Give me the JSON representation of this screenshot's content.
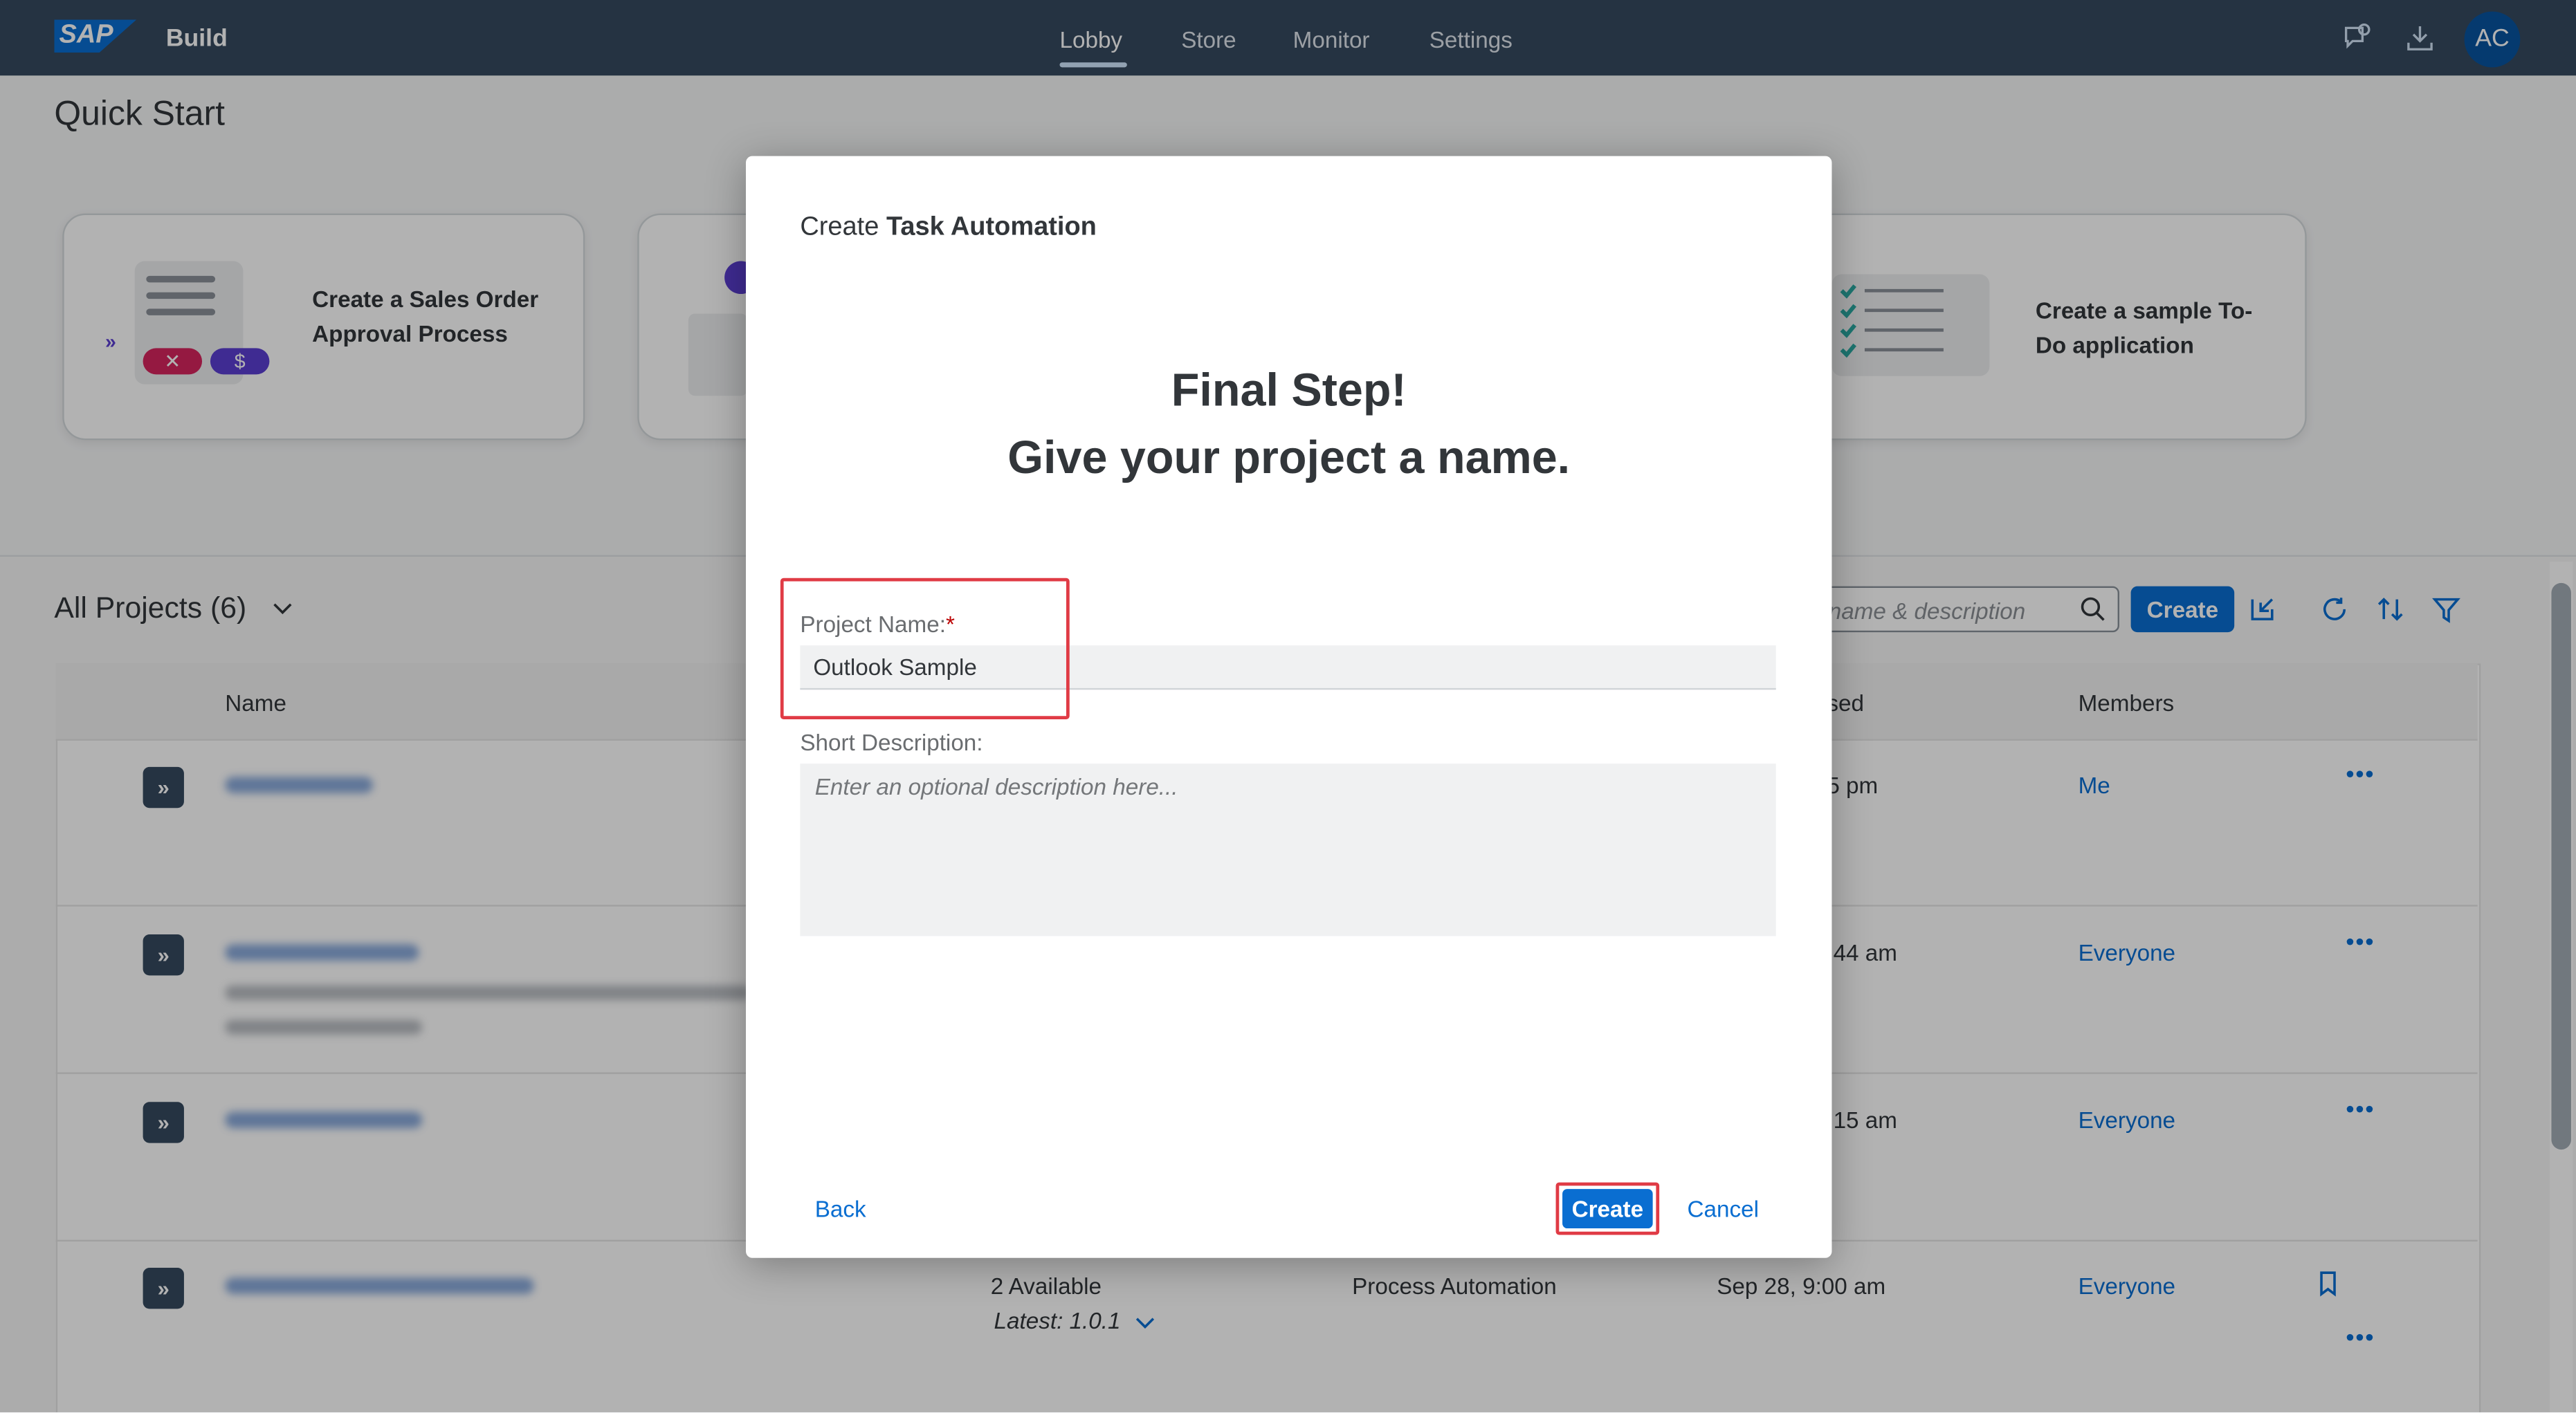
{
  "shell": {
    "logo": "SAP",
    "product": "Build",
    "nav": [
      "Lobby",
      "Store",
      "Monitor",
      "Settings"
    ],
    "active_nav": "Lobby",
    "avatar_initials": "AC",
    "icons": [
      "feedback-icon",
      "download-icon"
    ]
  },
  "quick_start": {
    "title": "Quick Start",
    "cards": [
      {
        "label": "Create a Sales Order Approval Process"
      },
      {
        "label": "Create a sample To-Do application"
      }
    ]
  },
  "projects": {
    "title": "All Projects (6)",
    "search_placeholder": "name & description",
    "create_label": "Create",
    "columns": {
      "name": "Name",
      "last_used": "sed",
      "members": "Members"
    },
    "rows": [
      {
        "time": "5 pm",
        "members": "Me"
      },
      {
        "time": ":44 am",
        "members": "Everyone"
      },
      {
        "time": ":15 am",
        "members": "Everyone"
      },
      {
        "versions": "2 Available",
        "latest": "Latest: 1.0.1",
        "type": "Process Automation",
        "time": "Sep 28, 9:00 am",
        "members": "Everyone"
      }
    ],
    "more_actions": "•••"
  },
  "dialog": {
    "title_prefix": "Create",
    "title_bold": "Task Automation",
    "heading_line1": "Final Step!",
    "heading_line2": "Give your project a name.",
    "project_name_label": "Project Name:",
    "required_mark": "*",
    "project_name_value": "Outlook Sample",
    "short_desc_label": "Short Description:",
    "short_desc_placeholder": "Enter an optional description here...",
    "back_label": "Back",
    "create_label": "Create",
    "cancel_label": "Cancel"
  },
  "colors": {
    "shell": "#354a5f",
    "accent": "#0a6ed1",
    "highlight": "#e03b45"
  }
}
